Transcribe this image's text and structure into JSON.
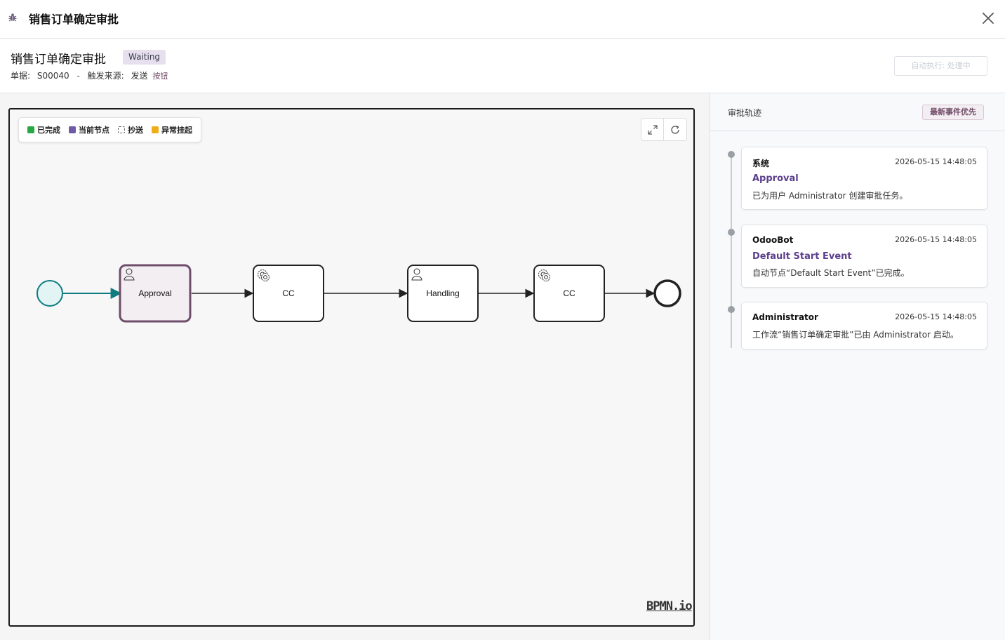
{
  "modal": {
    "title": "销售订单确定审批"
  },
  "doc": {
    "title": "销售订单确定审批",
    "state": "Waiting",
    "record_label": "单据:",
    "record_value": "S00040",
    "separator": "-",
    "trigger_label": "触发来源:",
    "trigger_value": "发送",
    "trigger_type": "按钮",
    "auto_button": "自动执行: 处理中"
  },
  "legend": {
    "items": [
      {
        "label": "已完成",
        "color": "#28a745"
      },
      {
        "label": "当前节点",
        "color": "#6f5aa5"
      },
      {
        "label": "抄送",
        "color": "dashed"
      },
      {
        "label": "异常挂起",
        "color": "#f0ad17"
      }
    ]
  },
  "diagram": {
    "nodes": [
      {
        "label": "Approval",
        "kind": "user-task",
        "state": "current"
      },
      {
        "label": "CC",
        "kind": "service-task",
        "state": "pending"
      },
      {
        "label": "Handling",
        "kind": "user-task",
        "state": "pending"
      },
      {
        "label": "CC",
        "kind": "service-task",
        "state": "pending"
      }
    ],
    "brand": "BPMN.io"
  },
  "side": {
    "title": "审批轨迹",
    "order_button": "最新事件优先",
    "events": [
      {
        "who": "系统",
        "time": "2026-05-15 14:48:05",
        "node": "Approval",
        "desc": "已为用户 Administrator 创建审批任务。"
      },
      {
        "who": "OdooBot",
        "time": "2026-05-15 14:48:05",
        "node": "Default Start Event",
        "desc": "自动节点“Default Start Event”已完成。"
      },
      {
        "who": "Administrator",
        "time": "2026-05-15 14:48:05",
        "node": "",
        "desc": "工作流“销售订单确定审批”已由 Administrator 启动。"
      }
    ]
  },
  "colors": {
    "accent": "#714b67",
    "current_node_fill": "#f3eef2",
    "current_node_stroke": "#6e4d6a",
    "start_event": "#0f7c80"
  }
}
